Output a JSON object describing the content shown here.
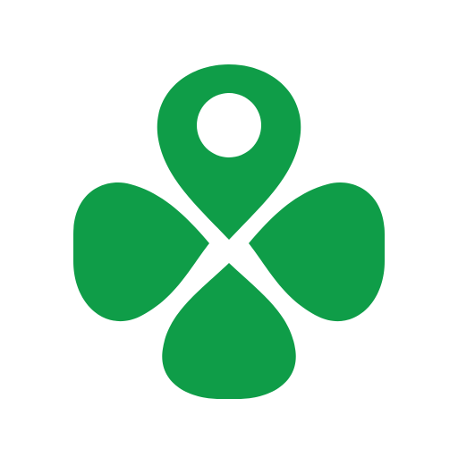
{
  "icon": {
    "name": "clover-location-pin-logo",
    "shape": "four-leaf-clover-with-map-pin-top-leaf",
    "colors": {
      "background": "#ffffff",
      "brand_green": "#0f9d48",
      "pin_hole": "#ffffff"
    }
  }
}
